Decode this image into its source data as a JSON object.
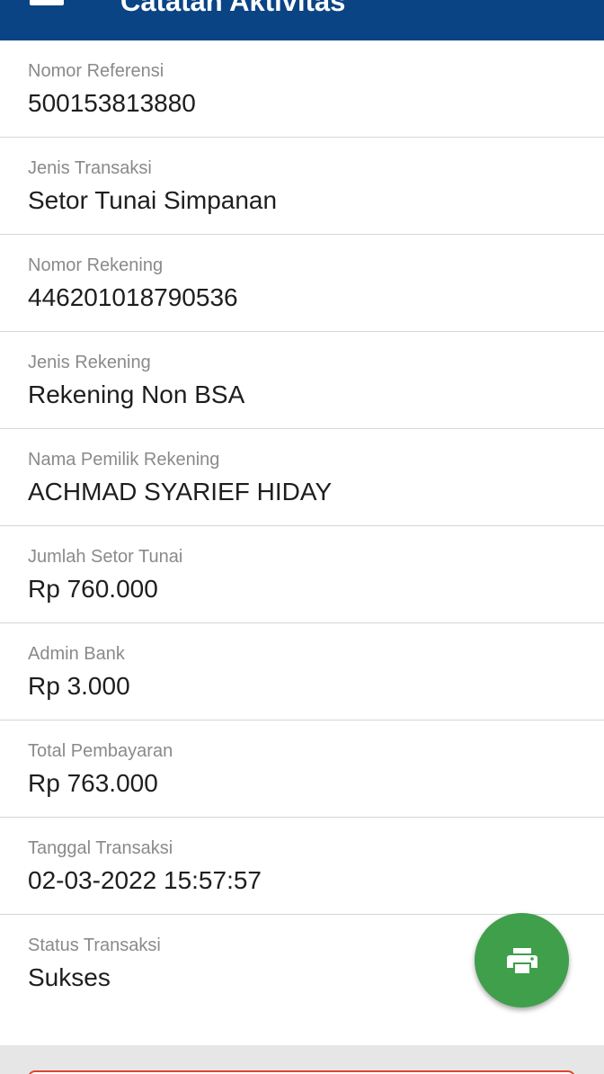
{
  "app_bar": {
    "title": "Catatan Aktivitas",
    "menu_icon": "menu-icon",
    "color": "#0a4485"
  },
  "fields": [
    {
      "label": "Nomor Referensi",
      "value": "500153813880"
    },
    {
      "label": "Jenis Transaksi",
      "value": "Setor Tunai Simpanan"
    },
    {
      "label": "Nomor Rekening",
      "value": "446201018790536"
    },
    {
      "label": "Jenis Rekening",
      "value": "Rekening Non BSA"
    },
    {
      "label": "Nama Pemilik Rekening",
      "value": "ACHMAD SYARIEF HIDAY"
    },
    {
      "label": "Jumlah Setor Tunai",
      "value": "Rp 760.000"
    },
    {
      "label": "Admin Bank",
      "value": "Rp 3.000"
    },
    {
      "label": "Total Pembayaran",
      "value": "Rp 763.000"
    },
    {
      "label": "Tanggal Transaksi",
      "value": "02-03-2022 15:57:57"
    },
    {
      "label": "Status Transaksi",
      "value": "Sukses"
    }
  ],
  "fab": {
    "icon": "print-icon",
    "color": "#3f9f4b"
  },
  "bottom_button": {
    "border_color": "#e0452f"
  }
}
